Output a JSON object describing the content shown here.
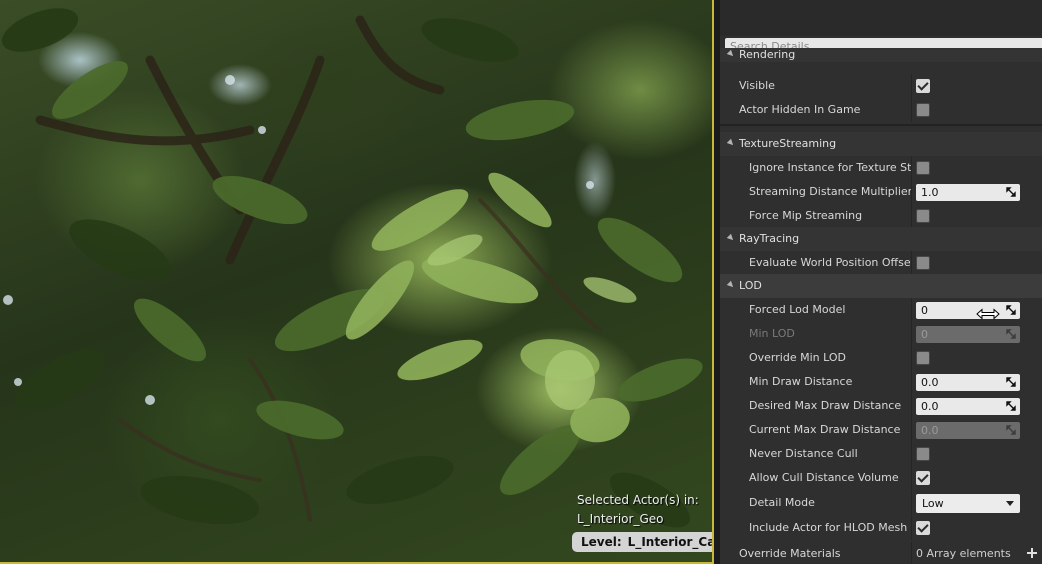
{
  "viewport": {
    "selected_label": "Selected Actor(s) in:",
    "selected_level": "L_Interior_Geo",
    "level_badge_prefix": "Level:",
    "level_badge_value": "L_Interior_Cars",
    "border_color": "#c8b83c"
  },
  "details": {
    "search_placeholder": "Search Details",
    "rendering": {
      "label": "Rendering",
      "visible": "Visible",
      "actor_hidden": "Actor Hidden In Game"
    },
    "texture_streaming": {
      "label": "TextureStreaming",
      "ignore_instance": "Ignore Instance for Texture Streaming",
      "streaming_distance_multiplier": "Streaming Distance Multiplier",
      "streaming_distance_multiplier_value": "1.0",
      "force_mip": "Force Mip Streaming"
    },
    "ray_tracing": {
      "label": "RayTracing",
      "evaluate_wpo": "Evaluate World Position Offset"
    },
    "lod": {
      "label": "LOD",
      "forced_lod_model": "Forced Lod Model",
      "forced_lod_model_value": "0",
      "min_lod": "Min LOD",
      "min_lod_value": "0",
      "override_min_lod": "Override Min LOD",
      "min_draw_distance": "Min Draw Distance",
      "min_draw_distance_value": "0.0",
      "desired_max_draw_distance": "Desired Max Draw Distance",
      "desired_max_draw_distance_value": "0.0",
      "current_max_draw_distance": "Current Max Draw Distance",
      "current_max_draw_distance_value": "0.0",
      "never_distance_cull": "Never Distance Cull",
      "allow_cull_distance_volume": "Allow Cull Distance Volume",
      "detail_mode": "Detail Mode",
      "detail_mode_value": "Low",
      "include_actor_hlod": "Include Actor for HLOD Mesh generation"
    },
    "override_materials": {
      "label": "Override Materials",
      "value": "0 Array elements"
    }
  }
}
